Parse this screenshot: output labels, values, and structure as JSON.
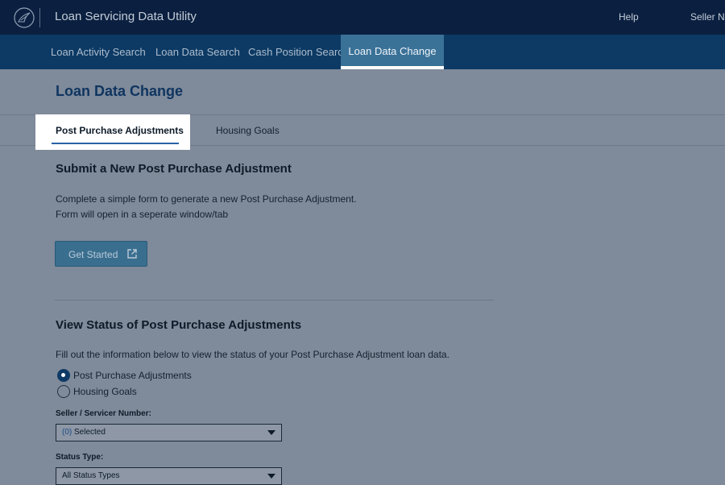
{
  "header": {
    "app_title": "Loan Servicing Data Utility",
    "help_label": "Help",
    "seller_label": "Seller No"
  },
  "nav": {
    "items": [
      {
        "label": "Loan Activity Search"
      },
      {
        "label": "Loan Data Search"
      },
      {
        "label": "Cash Position Search"
      },
      {
        "label": "Loan Data Change"
      }
    ],
    "active_index": 3
  },
  "page": {
    "title": "Loan Data Change"
  },
  "tabs": [
    {
      "label": "Post Purchase Adjustments",
      "active": true
    },
    {
      "label": "Housing Goals",
      "active": false
    }
  ],
  "submit_section": {
    "heading": "Submit a New Post Purchase Adjustment",
    "line1": "Complete a simple form to generate a new Post Purchase Adjustment.",
    "line2": "Form will open in a seperate window/tab",
    "button_label": "Get Started",
    "button_icon": "external-link-icon"
  },
  "status_section": {
    "heading": "View Status of Post Purchase Adjustments",
    "description": "Fill out the information below to view the status of your Post Purchase Adjustment loan data.",
    "radio_options": [
      {
        "label": "Post Purchase Adjustments",
        "selected": true
      },
      {
        "label": "Housing Goals",
        "selected": false
      }
    ],
    "seller_field": {
      "label": "Seller / Servicer Number:",
      "count": "(0)",
      "value": "Selected"
    },
    "status_field": {
      "label": "Status Type:",
      "value": "All Status Types"
    }
  },
  "colors": {
    "topbar": "#0b2040",
    "navbar": "#0c3a64",
    "nav_active": "#3a7197",
    "overlay_bg": "#7f8a9a",
    "title_blue": "#0f3560",
    "button": "#3a6e8f"
  }
}
